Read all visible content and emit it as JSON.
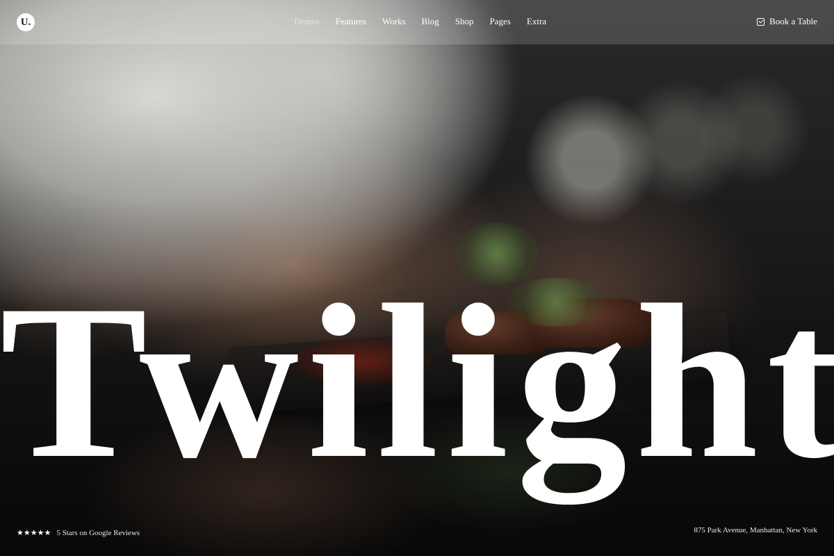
{
  "brand": {
    "logo_text": "U."
  },
  "nav": {
    "items": [
      {
        "label": "Demos",
        "active": true
      },
      {
        "label": "Features"
      },
      {
        "label": "Works"
      },
      {
        "label": "Blog"
      },
      {
        "label": "Shop"
      },
      {
        "label": "Pages"
      },
      {
        "label": "Extra"
      }
    ]
  },
  "cta": {
    "icon": "check-square-icon",
    "label": "Book a Table"
  },
  "hero": {
    "headline": "Twilight"
  },
  "footer": {
    "rating": {
      "stars": "★★★★★",
      "text": "5 Stars on Google Reviews"
    },
    "address": "875 Park Avenue, Manhattan, New York"
  },
  "colors": {
    "text": "#ffffff",
    "nav_active": "#bfbfbf",
    "overlay": "#ffffff"
  }
}
